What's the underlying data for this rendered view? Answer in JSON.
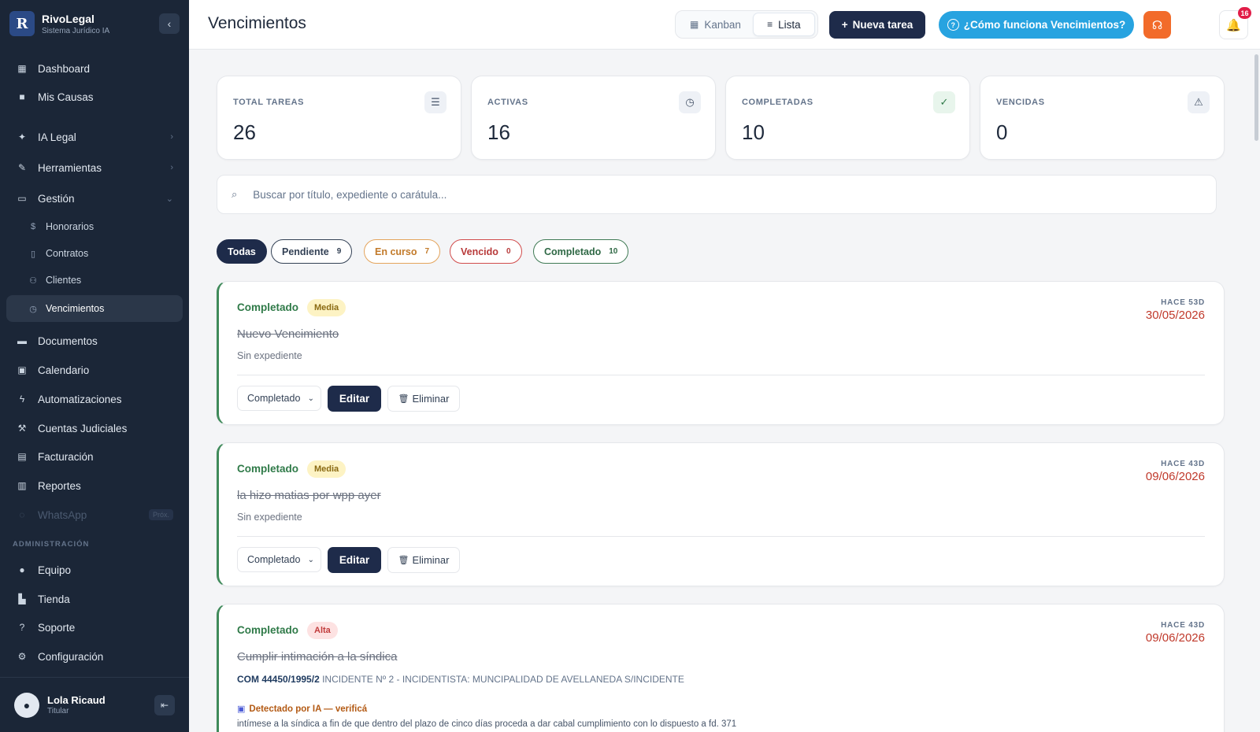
{
  "brand": {
    "logo_text": "R",
    "name": "RivoLegal",
    "subtitle": "Sistema Jurídico IA"
  },
  "sidebar": {
    "items": [
      {
        "label": "Dashboard",
        "icon": "dashboard-icon"
      },
      {
        "label": "Mis Causas",
        "icon": "briefcase-icon"
      },
      {
        "label": "IA Legal",
        "icon": "sparkle-icon"
      },
      {
        "label": "Herramientas",
        "icon": "wrench-icon"
      },
      {
        "label": "Gestión",
        "icon": "folder-icon"
      },
      {
        "label": "Honorarios",
        "icon": "dollar-icon"
      },
      {
        "label": "Contratos",
        "icon": "file-icon"
      },
      {
        "label": "Clientes",
        "icon": "users-icon"
      },
      {
        "label": "Vencimientos",
        "icon": "clock-icon"
      },
      {
        "label": "Documentos",
        "icon": "documents-icon"
      },
      {
        "label": "Calendario",
        "icon": "calendar-icon"
      },
      {
        "label": "Automatizaciones",
        "icon": "bolt-icon"
      },
      {
        "label": "Cuentas Judiciales",
        "icon": "gavel-icon"
      },
      {
        "label": "Facturación",
        "icon": "invoice-icon"
      },
      {
        "label": "Reportes",
        "icon": "bar-chart-icon"
      },
      {
        "label": "WhatsApp",
        "icon": "whatsapp-icon",
        "badge": "Próx."
      },
      {
        "label": "Equipo",
        "icon": "user-icon"
      },
      {
        "label": "Tienda",
        "icon": "store-icon"
      },
      {
        "label": "Soporte",
        "icon": "help-icon"
      },
      {
        "label": "Configuración",
        "icon": "gear-icon"
      }
    ],
    "section_admin": "ADMINISTRACIÓN",
    "active": "Vencimientos"
  },
  "user": {
    "name": "Lola Ricaud",
    "role": "Titular"
  },
  "header": {
    "title": "Vencimientos",
    "kanban_label": "Kanban",
    "lista_label": "Lista",
    "new_task_label": "Nueva tarea",
    "help_label": "¿Cómo funciona Vencimientos?",
    "notifications_count": "16"
  },
  "stats": [
    {
      "label": "TOTAL TAREAS",
      "value": "26",
      "icon": "list-icon"
    },
    {
      "label": "ACTIVAS",
      "value": "16",
      "icon": "clock-icon"
    },
    {
      "label": "COMPLETADAS",
      "value": "10",
      "icon": "check-circle-icon"
    },
    {
      "label": "VENCIDAS",
      "value": "0",
      "icon": "warning-icon"
    }
  ],
  "search": {
    "placeholder": "Buscar por título, expediente o carátula..."
  },
  "filters": [
    {
      "label": "Todas",
      "count": ""
    },
    {
      "label": "Pendiente",
      "count": "9"
    },
    {
      "label": "En curso",
      "count": "7"
    },
    {
      "label": "Vencido",
      "count": "0"
    },
    {
      "label": "Completado",
      "count": "10"
    }
  ],
  "tasks": [
    {
      "status": "Completado",
      "priority": "Media",
      "title": "Nuevo Vencimiento",
      "subtitle": "Sin expediente",
      "ago": "HACE 53D",
      "date": "30/05/2026",
      "select_value": "Completado",
      "edit_label": "Editar",
      "delete_label": "Eliminar"
    },
    {
      "status": "Completado",
      "priority": "Media",
      "title": "la hizo matias por wpp ayer",
      "subtitle": "Sin expediente",
      "ago": "HACE 43D",
      "date": "09/06/2026",
      "select_value": "Completado",
      "edit_label": "Editar",
      "delete_label": "Eliminar"
    },
    {
      "status": "Completado",
      "priority": "Alta",
      "title": "Cumplir intimación a la síndica",
      "expediente": "COM 44450/1995/2",
      "caratula": "INCIDENTE Nº 2 - INCIDENTISTA: MUNCIPALIDAD DE AVELLANEDA S/INCIDENTE",
      "ai_label": "Detectado por IA — verificá",
      "ai_text": "intímese a la síndica a fin de que dentro del plazo de cinco días proceda a dar cabal cumplimiento con lo dispuesto a fd. 371",
      "ago": "HACE 43D",
      "date": "09/06/2026"
    }
  ],
  "colors": {
    "sidebar_bg": "#1b2637",
    "primary": "#1e2b4a",
    "help_blue": "#27a3e0",
    "support_orange": "#f26b2a",
    "completed_green": "#2f7a48",
    "date_red": "#c0392b"
  }
}
